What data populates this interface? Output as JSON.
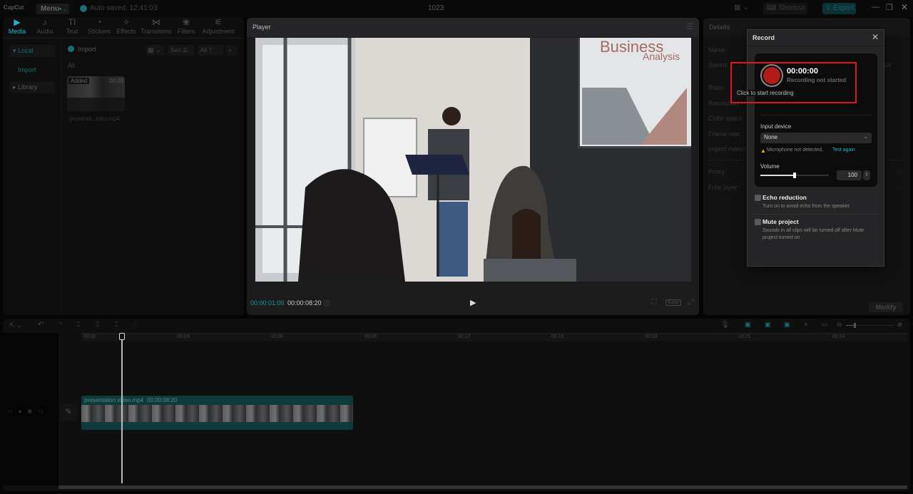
{
  "app": {
    "logo": "CapCut",
    "menu_label": "Menu",
    "autosave_text": "Auto saved: 12:41:03",
    "project_title": "1023",
    "shortcut_label": "Shortcut",
    "export_label": "Export",
    "accent": "#1fb9c3"
  },
  "toolbar_tabs": [
    {
      "label": "Media",
      "icon": "media-icon",
      "glyph": "▶",
      "active": true
    },
    {
      "label": "Audio",
      "icon": "audio-icon",
      "glyph": "♪"
    },
    {
      "label": "Text",
      "icon": "text-icon",
      "glyph": "TI"
    },
    {
      "label": "Stickers",
      "icon": "stickers-icon",
      "glyph": "◔"
    },
    {
      "label": "Effects",
      "icon": "effects-icon",
      "glyph": "✧"
    },
    {
      "label": "Transitions",
      "icon": "transitions-icon",
      "glyph": "⋈"
    },
    {
      "label": "Filters",
      "icon": "filters-icon",
      "glyph": "❀"
    },
    {
      "label": "Adjustment",
      "icon": "adjustment-icon",
      "glyph": "⚟"
    }
  ],
  "media_sidebar": {
    "local": "Local",
    "import": "Import",
    "library": "Library"
  },
  "media_panel": {
    "import_label": "Import",
    "sort_label": "Sort",
    "filter_all": "All",
    "section_all": "All",
    "items": [
      {
        "badge": "Added",
        "duration": "00:09",
        "name": "presenta...ideo.mp4"
      }
    ]
  },
  "player": {
    "title": "Player",
    "current_time": "00:00:01:09",
    "total_time": "00:00:08:20",
    "ratio_label": "Ratio",
    "slide_title_1": "Business",
    "slide_title_2": "Analysis"
  },
  "details": {
    "title": "Details",
    "fields": [
      "Name:",
      "Saved:",
      "Ratio:",
      "Resolution:",
      "Color space:",
      "Frame rate:",
      "Import materi"
    ],
    "saved_value_tail": "ut/",
    "proxy_label": "Proxy:",
    "free_layer_label": "Free layer:",
    "modify_label": "Modify"
  },
  "record_dialog": {
    "title": "Record",
    "timer": "00:00:00",
    "status": "Recording not started",
    "tooltip": "Click to start recording",
    "input_device_label": "Input device",
    "input_device_value": "None",
    "warning_text": "Microphone not detected,",
    "test_again_link": "Test again",
    "volume_label": "Volume",
    "volume_value": "100",
    "volume_fraction": 0.5,
    "echo_title": "Echo reduction",
    "echo_desc": "Turn on to avoid echo from the speaker",
    "mute_title": "Mute project",
    "mute_desc": "Sounds in all clips will be turned off after Mute project turned on",
    "highlight_color": "#e0151d",
    "record_button_color": "#b31b1b"
  },
  "timeline": {
    "ruler_ticks": [
      "00:00",
      "00:03",
      "00:06",
      "00:09",
      "00:12",
      "00:15",
      "00:18",
      "00:21",
      "00:24"
    ],
    "clip_name": "presentation video.mp4",
    "clip_duration": "00:00:08:20",
    "playhead_fraction": 0.15
  }
}
